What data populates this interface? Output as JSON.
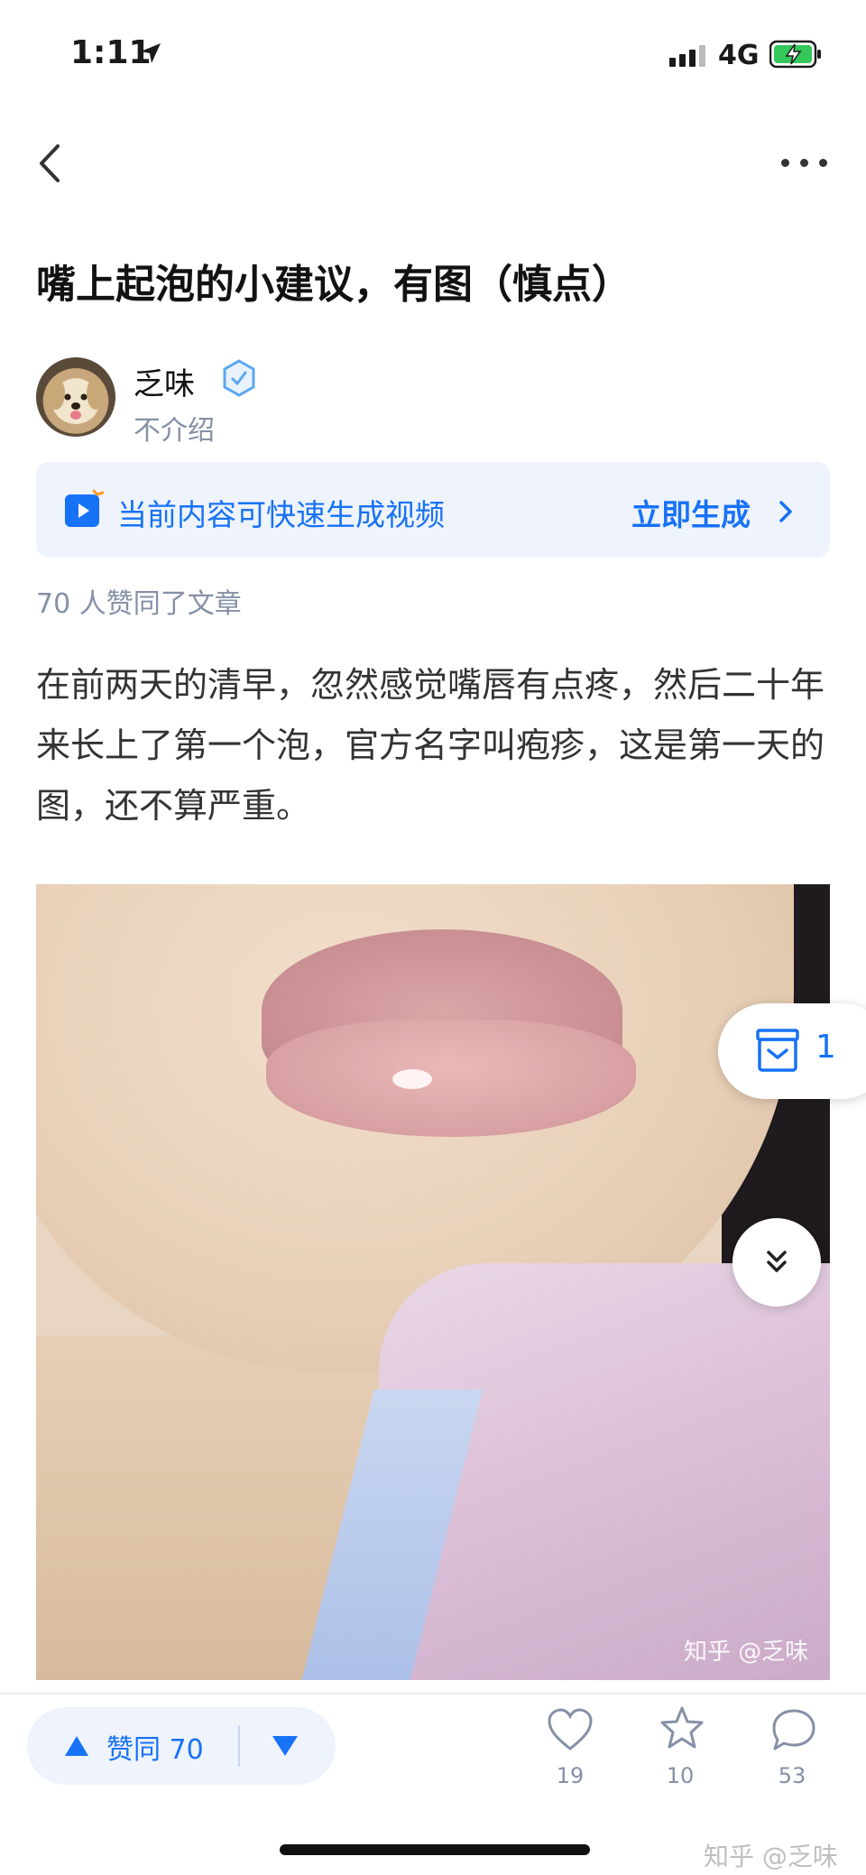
{
  "status_bar": {
    "time": "1:11",
    "network": "4G",
    "icons": [
      "location-arrow-icon",
      "signal-icon",
      "battery-charging-icon"
    ]
  },
  "nav": {
    "icons": [
      "back-chevron-icon",
      "more-dots-icon"
    ]
  },
  "article": {
    "title": "嘴上起泡的小建议，有图（慎点）",
    "author": {
      "name": "乏味",
      "bio": "不介绍"
    },
    "likes_line": "70 人赞同了文章",
    "body": "在前两天的清早，忽然感觉嘴唇有点疼，然后二十年来长上了第一个泡，官方名字叫疱疹，这是第一天的图，还不算严重。",
    "image_watermark": "知乎 @乏味"
  },
  "banner": {
    "text": "当前内容可快速生成视频",
    "action": "立即生成"
  },
  "floating": {
    "collection_count": "1"
  },
  "bottom_bar": {
    "vote_label": "赞同 70",
    "actions": [
      {
        "icon": "heart-icon",
        "count": "19"
      },
      {
        "icon": "star-icon",
        "count": "10"
      },
      {
        "icon": "comment-icon",
        "count": "53"
      }
    ]
  },
  "footer_watermark": "知乎 @乏味",
  "colors": {
    "accent": "#1772f6",
    "banner_bg": "#eef3fc",
    "muted": "#8590a6"
  }
}
